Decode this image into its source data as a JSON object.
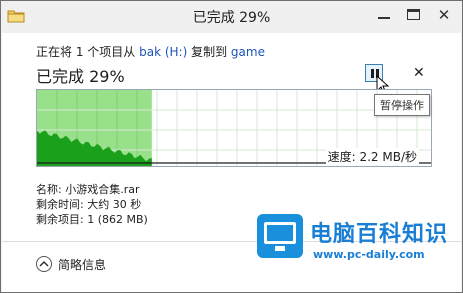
{
  "window": {
    "title": "已完成 29%",
    "minimize_icon": "minimize-icon",
    "maximize_icon": "maximize-icon",
    "close_icon": "close-icon"
  },
  "copy": {
    "prefix": "正在将 1 个项目从 ",
    "source": "bak (H:)",
    "middle": " 复制到 ",
    "destination": "game",
    "link_color": "#1f55b8"
  },
  "progress": {
    "title": "已完成 29%",
    "percent": 29,
    "speed_label": "速度:  2.2 MB/秒",
    "pause_tooltip": "暂停操作",
    "fill_color": "#98e08a",
    "graph_color": "#1aa01a"
  },
  "details": {
    "name": "名称: 小游戏合集.rar",
    "time_left": "剩余时间: 大约 30 秒",
    "items_left": "剩余项目: 1 (862 MB)"
  },
  "footer": {
    "less_info_label": "简略信息",
    "less_info_icon": "chevron-up-icon"
  },
  "watermark": {
    "title": "电脑百科知识",
    "url": "www.pc-daily.com",
    "color": "#1a7fd4"
  }
}
